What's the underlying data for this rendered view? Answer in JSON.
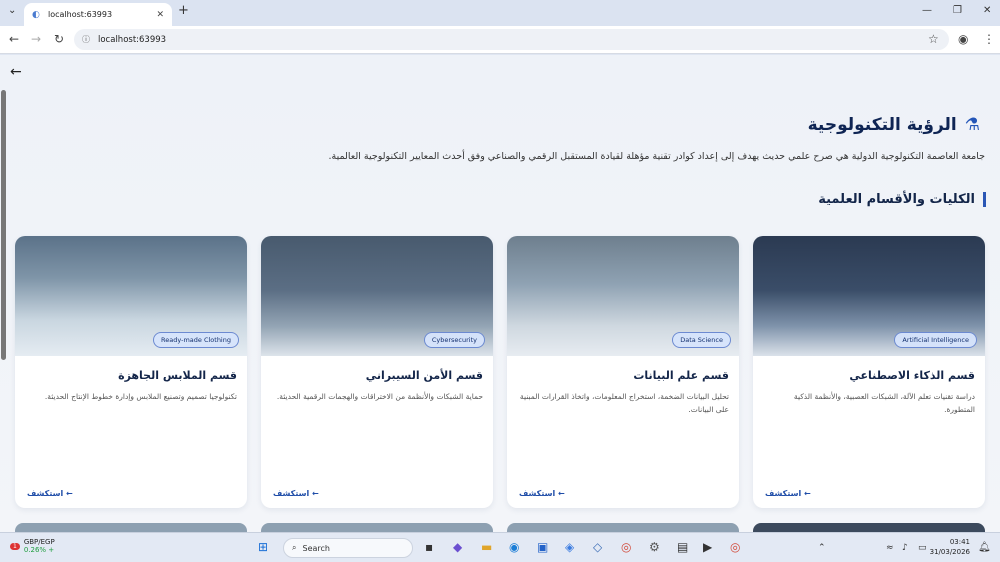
{
  "browser": {
    "tab_title": "localhost:63993",
    "url": "localhost:63993"
  },
  "page": {
    "vision_title": "الرؤية التكنولوجية",
    "vision_desc": "جامعة العاصمة التكنولوجية الدولية هي صرح علمي حديث يهدف إلى إعداد كوادر تقنية مؤهلة لقيادة المستقبل الرقمي والصناعي وفق أحدث المعايير التكنولوجية العالمية.",
    "section_title": "الكليات والأقسام العلمية",
    "explore_label": "استكشف ←"
  },
  "cards": [
    {
      "badge": "Artificial Intelligence",
      "title": "قسم الذكاء الاصطناعي",
      "text": "دراسة تقنيات تعلم الآلة، الشبكات العصبية، والأنظمة الذكية المتطورة."
    },
    {
      "badge": "Data Science",
      "title": "قسم علم البيانات",
      "text": "تحليل البيانات الضخمة، استخراج المعلومات، واتخاذ القرارات المبنية على البيانات."
    },
    {
      "badge": "Cybersecurity",
      "title": "قسم الأمن السيبراني",
      "text": "حماية الشبكات والأنظمة من الاختراقات والهجمات الرقمية الحديثة."
    },
    {
      "badge": "Ready-made Clothing",
      "title": "قسم الملابس الجاهزة",
      "text": "تكنولوجيا تصميم وتصنيع الملابس وإدارة خطوط الإنتاج الحديثة."
    }
  ],
  "taskbar": {
    "ticker": "GBP/EGP",
    "ticker_change": "0.26% +",
    "notif_count": "1",
    "search_label": "Search",
    "time": "03:41",
    "date": "31/03/2026"
  }
}
